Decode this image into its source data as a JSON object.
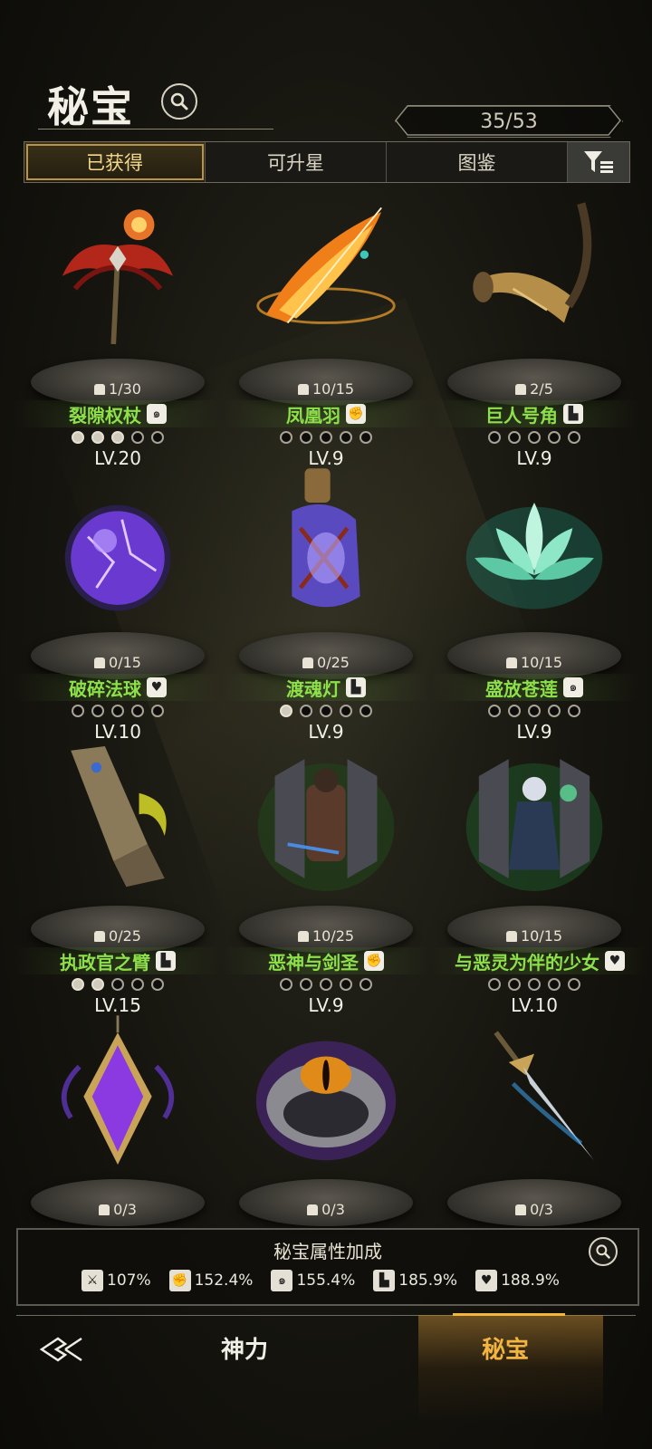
{
  "header": {
    "title": "秘宝",
    "count": "35/53"
  },
  "tabs": [
    {
      "label": "已获得"
    },
    {
      "label": "可升星"
    },
    {
      "label": "图鉴"
    }
  ],
  "items": [
    {
      "name": "裂隙权杖",
      "fragments": "1/30",
      "level": "LV.20",
      "stars": 3,
      "type_icon": "spiral-icon"
    },
    {
      "name": "凤凰羽",
      "fragments": "10/15",
      "level": "LV.9",
      "stars": 0,
      "type_icon": "fist-icon"
    },
    {
      "name": "巨人号角",
      "fragments": "2/5",
      "level": "LV.9",
      "stars": 0,
      "type_icon": "boot-icon"
    },
    {
      "name": "破碎法球",
      "fragments": "0/15",
      "level": "LV.10",
      "stars": 0,
      "type_icon": "heart-icon"
    },
    {
      "name": "渡魂灯",
      "fragments": "0/25",
      "level": "LV.9",
      "stars": 1,
      "type_icon": "boot-icon"
    },
    {
      "name": "盛放苍莲",
      "fragments": "10/15",
      "level": "LV.9",
      "stars": 0,
      "type_icon": "spiral-icon"
    },
    {
      "name": "执政官之臂",
      "fragments": "0/25",
      "level": "LV.15",
      "stars": 2,
      "type_icon": "boot-icon"
    },
    {
      "name": "恶神与剑圣",
      "fragments": "10/25",
      "level": "LV.9",
      "stars": 0,
      "type_icon": "fist-icon"
    },
    {
      "name": "与恶灵为伴的少女",
      "fragments": "10/15",
      "level": "LV.10",
      "stars": 0,
      "type_icon": "heart-icon"
    },
    {
      "name": "",
      "fragments": "0/3",
      "level": "",
      "stars": 0,
      "type_icon": ""
    },
    {
      "name": "",
      "fragments": "0/3",
      "level": "",
      "stars": 0,
      "type_icon": ""
    },
    {
      "name": "",
      "fragments": "0/3",
      "level": "",
      "stars": 0,
      "type_icon": ""
    }
  ],
  "stats": {
    "title": "秘宝属性加成",
    "values": [
      {
        "icon": "sword-icon",
        "value": "107%"
      },
      {
        "icon": "fist-icon",
        "value": "152.4%"
      },
      {
        "icon": "spiral-icon",
        "value": "155.4%"
      },
      {
        "icon": "boot-icon",
        "value": "185.9%"
      },
      {
        "icon": "heart-icon",
        "value": "188.9%"
      }
    ]
  },
  "nav": {
    "shenli": "神力",
    "mibao": "秘宝"
  },
  "colors": {
    "accent": "#f3b542",
    "name_green": "#8ee04a"
  }
}
